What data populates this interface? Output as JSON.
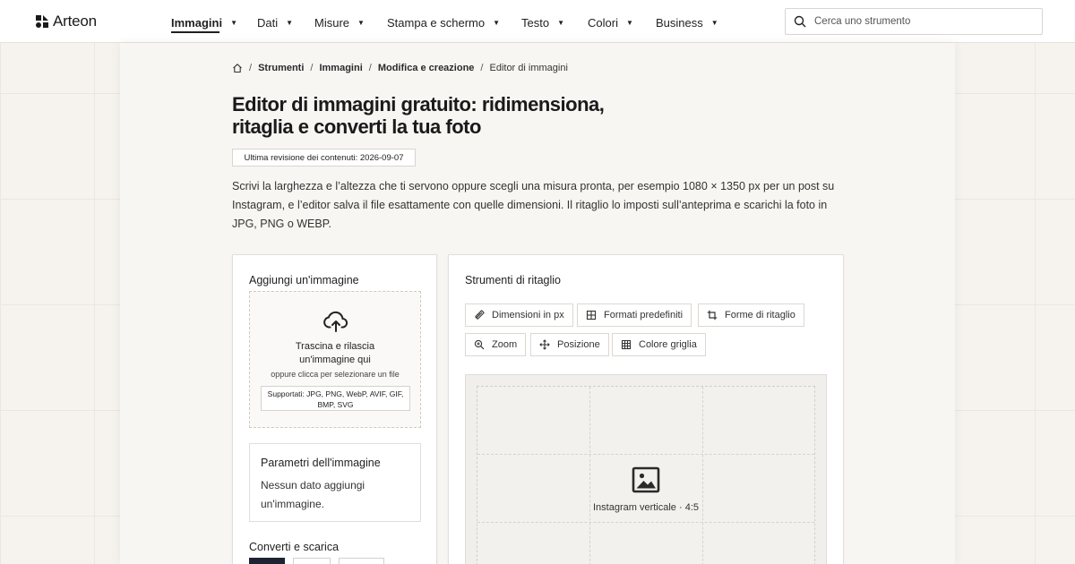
{
  "brand": {
    "name": "Arteon"
  },
  "nav": {
    "items": [
      {
        "label": "Immagini",
        "active": true
      },
      {
        "label": "Dati"
      },
      {
        "label": "Misure"
      },
      {
        "label": "Stampa e schermo"
      },
      {
        "label": "Testo"
      },
      {
        "label": "Colori"
      },
      {
        "label": "Business"
      }
    ],
    "caret": "▼"
  },
  "search": {
    "placeholder": "Cerca uno strumento",
    "value": ""
  },
  "breadcrumb": {
    "items": [
      "Strumenti",
      "Immagini",
      "Modifica e creazione",
      "Editor di immagini"
    ],
    "separator": "/"
  },
  "page": {
    "title": "Editor di immagini gratuito: ridimensiona, ritaglia e converti la tua foto",
    "revision": "Ultima revisione dei contenuti: 2026-09-07",
    "intro": "Scrivi la larghezza e l’altezza che ti servono oppure scegli una misura pronta, per esempio 1080 × 1350 px per un post su Instagram, e l’editor salva il file esattamente con quelle dimensioni. Il ritaglio lo imposti sull’anteprima e scarichi la foto in JPG, PNG o WEBP."
  },
  "upload": {
    "title": "Aggiungi un'immagine",
    "drop_text": "Trascina e rilascia un'immagine qui",
    "click_text": "oppure clicca per selezionare un file",
    "formats": "Supportati: JPG, PNG, WebP, AVIF, GIF, BMP, SVG"
  },
  "params": {
    "title": "Parametri dell'immagine",
    "empty_text": "Nessun dato aggiungi un'immagine."
  },
  "convert": {
    "title": "Converti e scarica"
  },
  "crop_tools": {
    "title": "Strumenti di ritaglio",
    "buttons": [
      {
        "label": "Dimensioni in px",
        "icon": "ruler-icon"
      },
      {
        "label": "Formati predefiniti",
        "icon": "grid-icon"
      },
      {
        "label": "Forme di ritaglio",
        "icon": "crop-icon"
      },
      {
        "label": "Zoom",
        "icon": "zoom-icon"
      },
      {
        "label": "Posizione",
        "icon": "move-icon"
      },
      {
        "label": "Colore griglia",
        "icon": "grid-color-icon"
      }
    ]
  },
  "preview": {
    "label": "Instagram verticale · 4:5"
  }
}
